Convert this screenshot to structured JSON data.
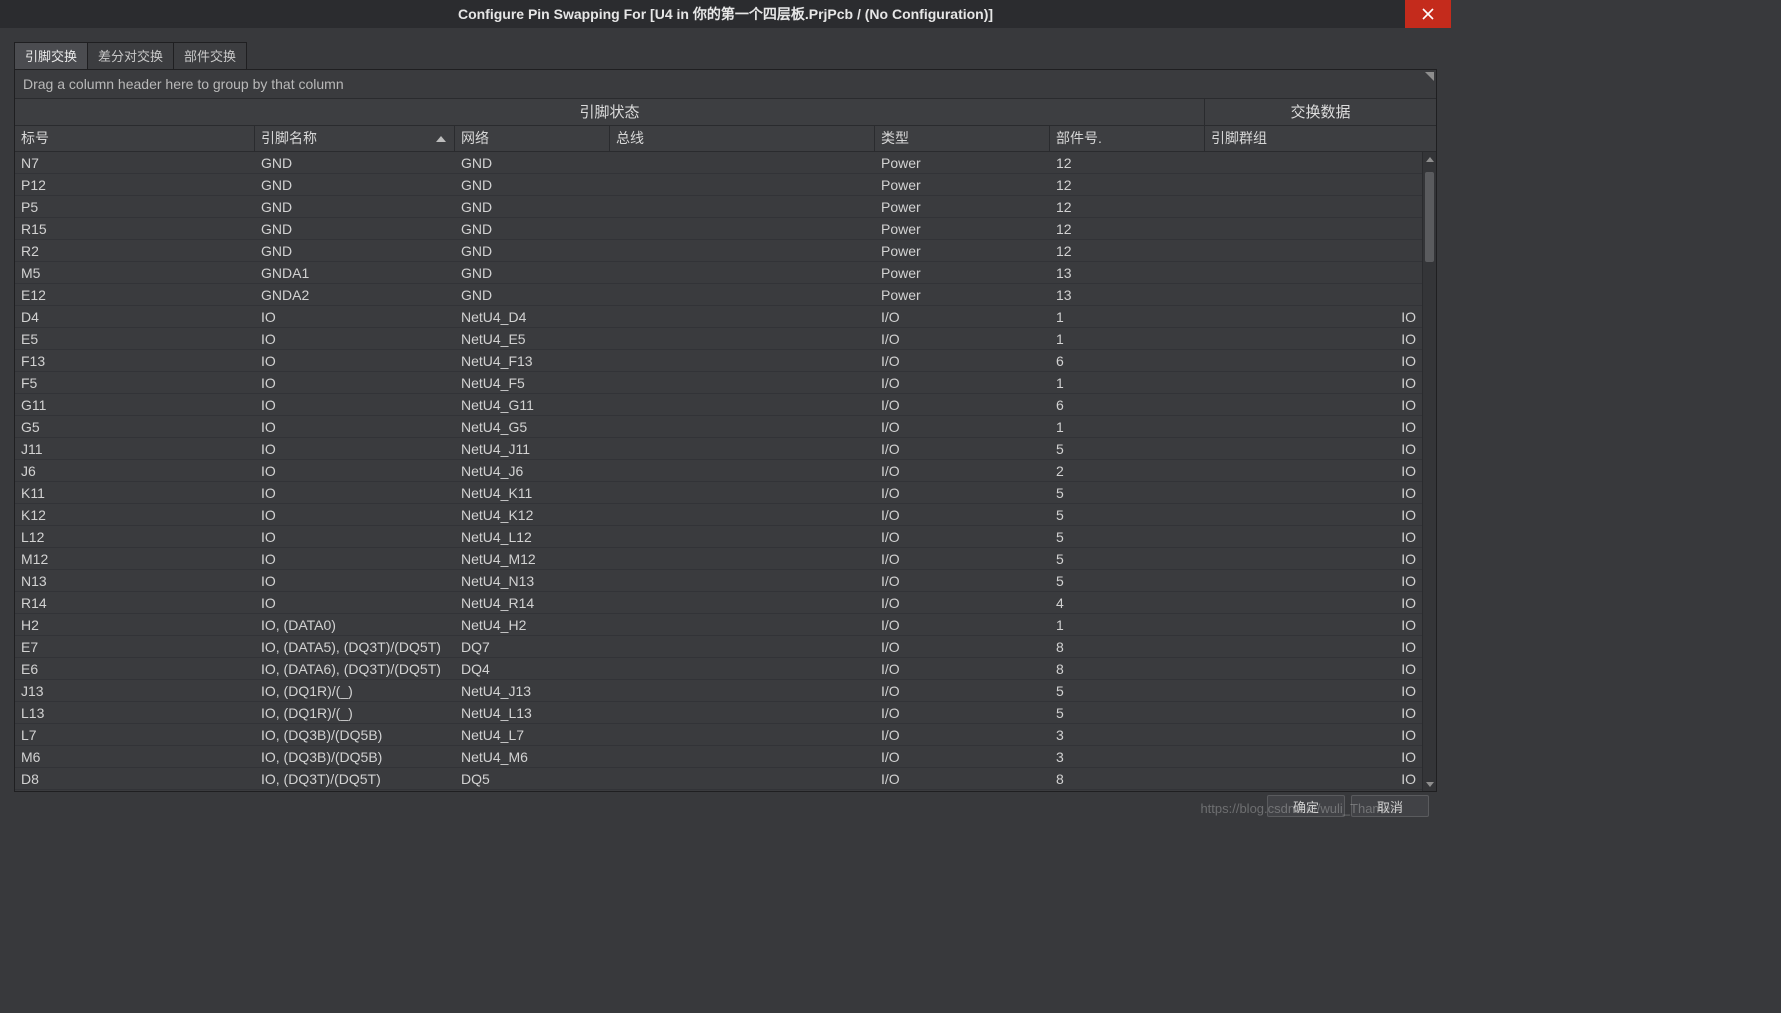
{
  "title": "Configure Pin Swapping For [U4 in 你的第一个四层板.PrjPcb / (No Configuration)]",
  "tabs": [
    {
      "label": "引脚交换",
      "active": true
    },
    {
      "label": "差分对交换",
      "active": false
    },
    {
      "label": "部件交换",
      "active": false
    }
  ],
  "group_bar": "Drag a column header here to group by that column",
  "super_headers": {
    "pin_status": "引脚状态",
    "swap_data": "交换数据"
  },
  "columns": {
    "designator": "标号",
    "pin_name": "引脚名称",
    "net": "网络",
    "bus": "总线",
    "type": "类型",
    "part_no": "部件号.",
    "pin_group": "引脚群组"
  },
  "sort_column": "pin_name",
  "rows": [
    {
      "des": "N7",
      "name": "GND",
      "net": "GND",
      "bus": "",
      "type": "Power",
      "part": "12",
      "grp": ""
    },
    {
      "des": "P12",
      "name": "GND",
      "net": "GND",
      "bus": "",
      "type": "Power",
      "part": "12",
      "grp": ""
    },
    {
      "des": "P5",
      "name": "GND",
      "net": "GND",
      "bus": "",
      "type": "Power",
      "part": "12",
      "grp": ""
    },
    {
      "des": "R15",
      "name": "GND",
      "net": "GND",
      "bus": "",
      "type": "Power",
      "part": "12",
      "grp": ""
    },
    {
      "des": "R2",
      "name": "GND",
      "net": "GND",
      "bus": "",
      "type": "Power",
      "part": "12",
      "grp": ""
    },
    {
      "des": "M5",
      "name": "GNDA1",
      "net": "GND",
      "bus": "",
      "type": "Power",
      "part": "13",
      "grp": ""
    },
    {
      "des": "E12",
      "name": "GNDA2",
      "net": "GND",
      "bus": "",
      "type": "Power",
      "part": "13",
      "grp": ""
    },
    {
      "des": "D4",
      "name": "IO",
      "net": "NetU4_D4",
      "bus": "",
      "type": "I/O",
      "part": "1",
      "grp": "IO"
    },
    {
      "des": "E5",
      "name": "IO",
      "net": "NetU4_E5",
      "bus": "",
      "type": "I/O",
      "part": "1",
      "grp": "IO"
    },
    {
      "des": "F13",
      "name": "IO",
      "net": "NetU4_F13",
      "bus": "",
      "type": "I/O",
      "part": "6",
      "grp": "IO"
    },
    {
      "des": "F5",
      "name": "IO",
      "net": "NetU4_F5",
      "bus": "",
      "type": "I/O",
      "part": "1",
      "grp": "IO"
    },
    {
      "des": "G11",
      "name": "IO",
      "net": "NetU4_G11",
      "bus": "",
      "type": "I/O",
      "part": "6",
      "grp": "IO"
    },
    {
      "des": "G5",
      "name": "IO",
      "net": "NetU4_G5",
      "bus": "",
      "type": "I/O",
      "part": "1",
      "grp": "IO"
    },
    {
      "des": "J11",
      "name": "IO",
      "net": "NetU4_J11",
      "bus": "",
      "type": "I/O",
      "part": "5",
      "grp": "IO"
    },
    {
      "des": "J6",
      "name": "IO",
      "net": "NetU4_J6",
      "bus": "",
      "type": "I/O",
      "part": "2",
      "grp": "IO"
    },
    {
      "des": "K11",
      "name": "IO",
      "net": "NetU4_K11",
      "bus": "",
      "type": "I/O",
      "part": "5",
      "grp": "IO"
    },
    {
      "des": "K12",
      "name": "IO",
      "net": "NetU4_K12",
      "bus": "",
      "type": "I/O",
      "part": "5",
      "grp": "IO"
    },
    {
      "des": "L12",
      "name": "IO",
      "net": "NetU4_L12",
      "bus": "",
      "type": "I/O",
      "part": "5",
      "grp": "IO"
    },
    {
      "des": "M12",
      "name": "IO",
      "net": "NetU4_M12",
      "bus": "",
      "type": "I/O",
      "part": "5",
      "grp": "IO"
    },
    {
      "des": "N13",
      "name": "IO",
      "net": "NetU4_N13",
      "bus": "",
      "type": "I/O",
      "part": "5",
      "grp": "IO"
    },
    {
      "des": "R14",
      "name": "IO",
      "net": "NetU4_R14",
      "bus": "",
      "type": "I/O",
      "part": "4",
      "grp": "IO"
    },
    {
      "des": "H2",
      "name": "IO, (DATA0)",
      "net": "NetU4_H2",
      "bus": "",
      "type": "I/O",
      "part": "1",
      "grp": "IO"
    },
    {
      "des": "E7",
      "name": "IO, (DATA5), (DQ3T)/(DQ5T)",
      "net": "DQ7",
      "bus": "",
      "type": "I/O",
      "part": "8",
      "grp": "IO"
    },
    {
      "des": "E6",
      "name": "IO, (DATA6), (DQ3T)/(DQ5T)",
      "net": "DQ4",
      "bus": "",
      "type": "I/O",
      "part": "8",
      "grp": "IO"
    },
    {
      "des": "J13",
      "name": "IO, (DQ1R)/(_)",
      "net": "NetU4_J13",
      "bus": "",
      "type": "I/O",
      "part": "5",
      "grp": "IO"
    },
    {
      "des": "L13",
      "name": "IO, (DQ1R)/(_)",
      "net": "NetU4_L13",
      "bus": "",
      "type": "I/O",
      "part": "5",
      "grp": "IO"
    },
    {
      "des": "L7",
      "name": "IO, (DQ3B)/(DQ5B)",
      "net": "NetU4_L7",
      "bus": "",
      "type": "I/O",
      "part": "3",
      "grp": "IO"
    },
    {
      "des": "M6",
      "name": "IO, (DQ3B)/(DQ5B)",
      "net": "NetU4_M6",
      "bus": "",
      "type": "I/O",
      "part": "3",
      "grp": "IO"
    },
    {
      "des": "D8",
      "name": "IO, (DQ3T)/(DQ5T)",
      "net": "DQ5",
      "bus": "",
      "type": "I/O",
      "part": "8",
      "grp": "IO"
    }
  ],
  "buttons": {
    "ok": "确定",
    "cancel": "取消"
  },
  "watermark": "https://blog.csdn.net/wuli_Thames"
}
